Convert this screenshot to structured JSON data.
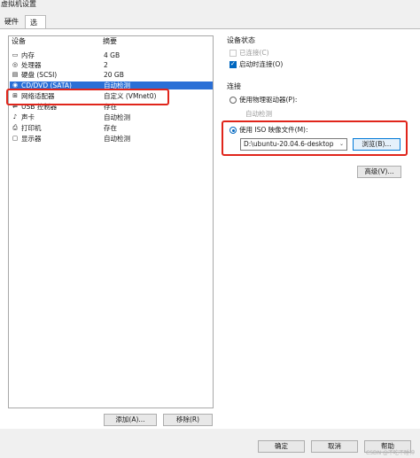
{
  "window": {
    "title": "虚拟机设置"
  },
  "tabs": [
    {
      "label": "硬件"
    },
    {
      "label": "选项"
    }
  ],
  "device_list": {
    "headers": {
      "device": "设备",
      "summary": "摘要"
    },
    "rows": [
      {
        "icon": "memory-icon",
        "name": "内存",
        "summary": "4 GB"
      },
      {
        "icon": "cpu-icon",
        "name": "处理器",
        "summary": "2"
      },
      {
        "icon": "disk-icon",
        "name": "硬盘 (SCSI)",
        "summary": "20 GB"
      },
      {
        "icon": "cd-dvd-icon",
        "name": "CD/DVD (SATA)",
        "summary": "自动检测",
        "selected": true
      },
      {
        "icon": "network-icon",
        "name": "网络适配器",
        "summary": "自定义 (VMnet0)"
      },
      {
        "icon": "usb-icon",
        "name": "USB 控制器",
        "summary": "存在"
      },
      {
        "icon": "sound-icon",
        "name": "声卡",
        "summary": "自动检测"
      },
      {
        "icon": "printer-icon",
        "name": "打印机",
        "summary": "存在"
      },
      {
        "icon": "display-icon",
        "name": "显示器",
        "summary": "自动检测"
      }
    ]
  },
  "device_status": {
    "title": "设备状态",
    "connected": {
      "label": "已连接(C)",
      "checked": false,
      "enabled": false
    },
    "connect_on_power": {
      "label": "启动时连接(O)",
      "checked": true
    }
  },
  "connection": {
    "title": "连接",
    "physical": {
      "label": "使用物理驱动器(P):",
      "selected": false,
      "value": "自动检测"
    },
    "iso": {
      "label": "使用 ISO 映像文件(M):",
      "selected": true,
      "value": "D:\\ubuntu-20.04.6-desktop"
    },
    "browse_label": "浏览(B)...",
    "advanced_label": "高级(V)..."
  },
  "list_buttons": {
    "add": "添加(A)...",
    "remove": "移除(R)"
  },
  "footer": {
    "ok": "确定",
    "cancel": "取消",
    "help": "帮助"
  },
  "watermark": "CSDN @不吃不睡神",
  "colors": {
    "selection": "#2a6fd6",
    "annotation": "#e0251b",
    "accent": "#0067c0"
  }
}
